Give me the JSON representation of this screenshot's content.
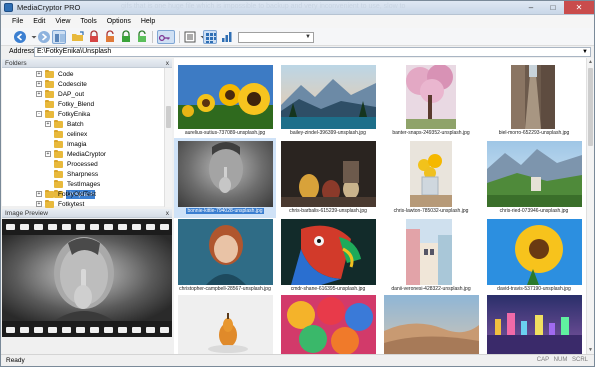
{
  "window": {
    "title": "MediaCryptor PRO",
    "background_text": "gifs that is one huge file which is impossible to backup and very inconvenient to use, slow to"
  },
  "menu": [
    "File",
    "Edit",
    "View",
    "Tools",
    "Options",
    "Help"
  ],
  "toolbar": {
    "icons": [
      "back-icon",
      "forward-icon",
      "folder-view-icon",
      "open-folder-icon",
      "encrypt-lock-icon",
      "decrypt-unlock-icon",
      "lock-all-icon",
      "unlock-all-icon",
      "key-icon",
      "slideshow-icon",
      "details-view-icon",
      "thumbnails-view-icon",
      "chart-icon"
    ],
    "combo_value": ""
  },
  "address": {
    "label": "Address",
    "value": "E:\\FotkyEnika\\Unsplash"
  },
  "folders": {
    "header": "Folders",
    "items": [
      {
        "label": "Code",
        "expander": "+"
      },
      {
        "label": "Codescite",
        "expander": "+"
      },
      {
        "label": "DAP_out",
        "expander": "+"
      },
      {
        "label": "Fotky_Blend",
        "expander": ""
      },
      {
        "label": "FotkyEnika",
        "expander": "-"
      },
      {
        "label": "Batch",
        "expander": "+"
      },
      {
        "label": "celinex",
        "expander": ""
      },
      {
        "label": "Imagia",
        "expander": ""
      },
      {
        "label": "MediaCryptor",
        "expander": "+"
      },
      {
        "label": "Processed",
        "expander": ""
      },
      {
        "label": "Sharpness",
        "expander": ""
      },
      {
        "label": "TestImages",
        "expander": ""
      },
      {
        "label": "Unsplash",
        "expander": "",
        "selected": true
      },
      {
        "label": "FotkyOldTest",
        "expander": "+"
      },
      {
        "label": "Fotkytest",
        "expander": "+"
      }
    ]
  },
  "preview": {
    "header": "Image Preview",
    "close_symbol": "x"
  },
  "folders_close_symbol": "x",
  "gallery": {
    "items": [
      {
        "caption": "aurelius-sutius-737089-unsplash.jpg"
      },
      {
        "caption": "bailey-zindel-396399-unsplash.jpg"
      },
      {
        "caption": "banter-snaps-249352-unsplash.jpg"
      },
      {
        "caption": "biel-morro-652293-unsplash.jpg"
      },
      {
        "caption": "bonnie-kittle-794028-unsplash.jpg",
        "selected": true
      },
      {
        "caption": "chris-barbalis-615239-unsplash.jpg"
      },
      {
        "caption": "chris-lawton-785032-unsplash.jpg"
      },
      {
        "caption": "chris-ried-073946-unsplash.jpg"
      },
      {
        "caption": "christopher-campbell-28567-unsplash.jpg"
      },
      {
        "caption": "cmdr-shane-616395-unsplash.jpg"
      },
      {
        "caption": "danii-veronesi-428322-unsplash.jpg"
      },
      {
        "caption": "david-travis-537190-unsplash.jpg"
      },
      {
        "caption": ""
      },
      {
        "caption": ""
      },
      {
        "caption": ""
      },
      {
        "caption": ""
      }
    ]
  },
  "status": {
    "left": "Ready",
    "right": "CAP NUM SCRL"
  },
  "colors": {
    "selection": "#3b7fd1",
    "titlebar": "#c9d7e8",
    "folder": "#e8b93c"
  }
}
